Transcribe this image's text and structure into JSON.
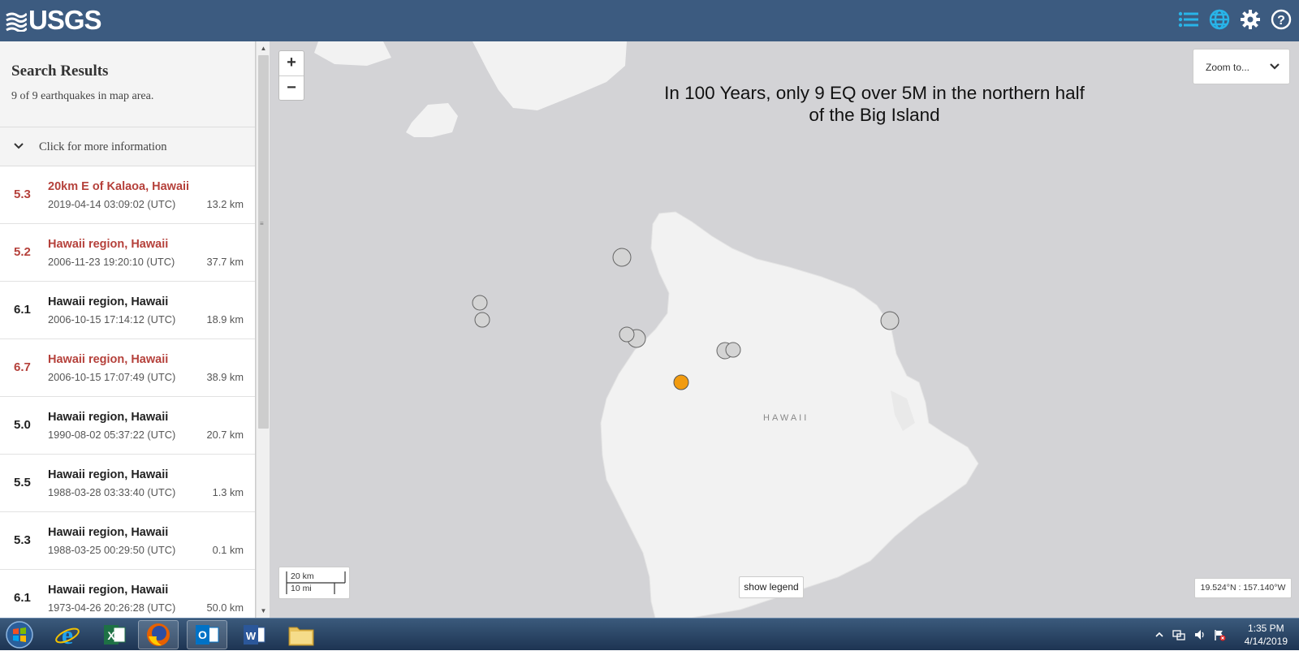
{
  "header": {
    "logo_text": "USGS"
  },
  "sidebar": {
    "title": "Search Results",
    "count_text": "9 of 9 earthquakes in map area.",
    "more_info_label": "Click for more information",
    "earthquakes": [
      {
        "mag": "5.3",
        "title": "20km E of Kalaoa, Hawaii",
        "time": "2019-04-14 03:09:02 (UTC)",
        "depth": "13.2 km",
        "highlight": true
      },
      {
        "mag": "5.2",
        "title": "Hawaii region, Hawaii",
        "time": "2006-11-23 19:20:10 (UTC)",
        "depth": "37.7 km",
        "highlight": true
      },
      {
        "mag": "6.1",
        "title": "Hawaii region, Hawaii",
        "time": "2006-10-15 17:14:12 (UTC)",
        "depth": "18.9 km",
        "highlight": false
      },
      {
        "mag": "6.7",
        "title": "Hawaii region, Hawaii",
        "time": "2006-10-15 17:07:49 (UTC)",
        "depth": "38.9 km",
        "highlight": true
      },
      {
        "mag": "5.0",
        "title": "Hawaii region, Hawaii",
        "time": "1990-08-02 05:37:22 (UTC)",
        "depth": "20.7 km",
        "highlight": false
      },
      {
        "mag": "5.5",
        "title": "Hawaii region, Hawaii",
        "time": "1988-03-28 03:33:40 (UTC)",
        "depth": "1.3 km",
        "highlight": false
      },
      {
        "mag": "5.3",
        "title": "Hawaii region, Hawaii",
        "time": "1988-03-25 00:29:50 (UTC)",
        "depth": "0.1 km",
        "highlight": false
      },
      {
        "mag": "6.1",
        "title": "Hawaii region, Hawaii",
        "time": "1973-04-26 20:26:28 (UTC)",
        "depth": "50.0 km",
        "highlight": false
      }
    ]
  },
  "map": {
    "zoom_in": "+",
    "zoom_out": "−",
    "zoom_to_label": "Zoom to...",
    "caption_line1": "In 100 Years, only 9 EQ over 5M in the northern half",
    "caption_line2": "of the Big Island",
    "region_label": "HAWAII",
    "scale_km": "20 km",
    "scale_mi": "10 mi",
    "legend_button": "show legend",
    "coords": "19.524°N : 157.140°W",
    "colors": {
      "water": "#d3d3d6",
      "land": "#f2f2f2",
      "marker_recent": "#f29b0f",
      "marker_old": "#d4d4d4"
    }
  },
  "taskbar": {
    "apps": [
      "start-orb",
      "internet-explorer",
      "excel",
      "firefox",
      "outlook",
      "word",
      "file-explorer"
    ],
    "clock_time": "1:35 PM",
    "clock_date": "4/14/2019"
  }
}
